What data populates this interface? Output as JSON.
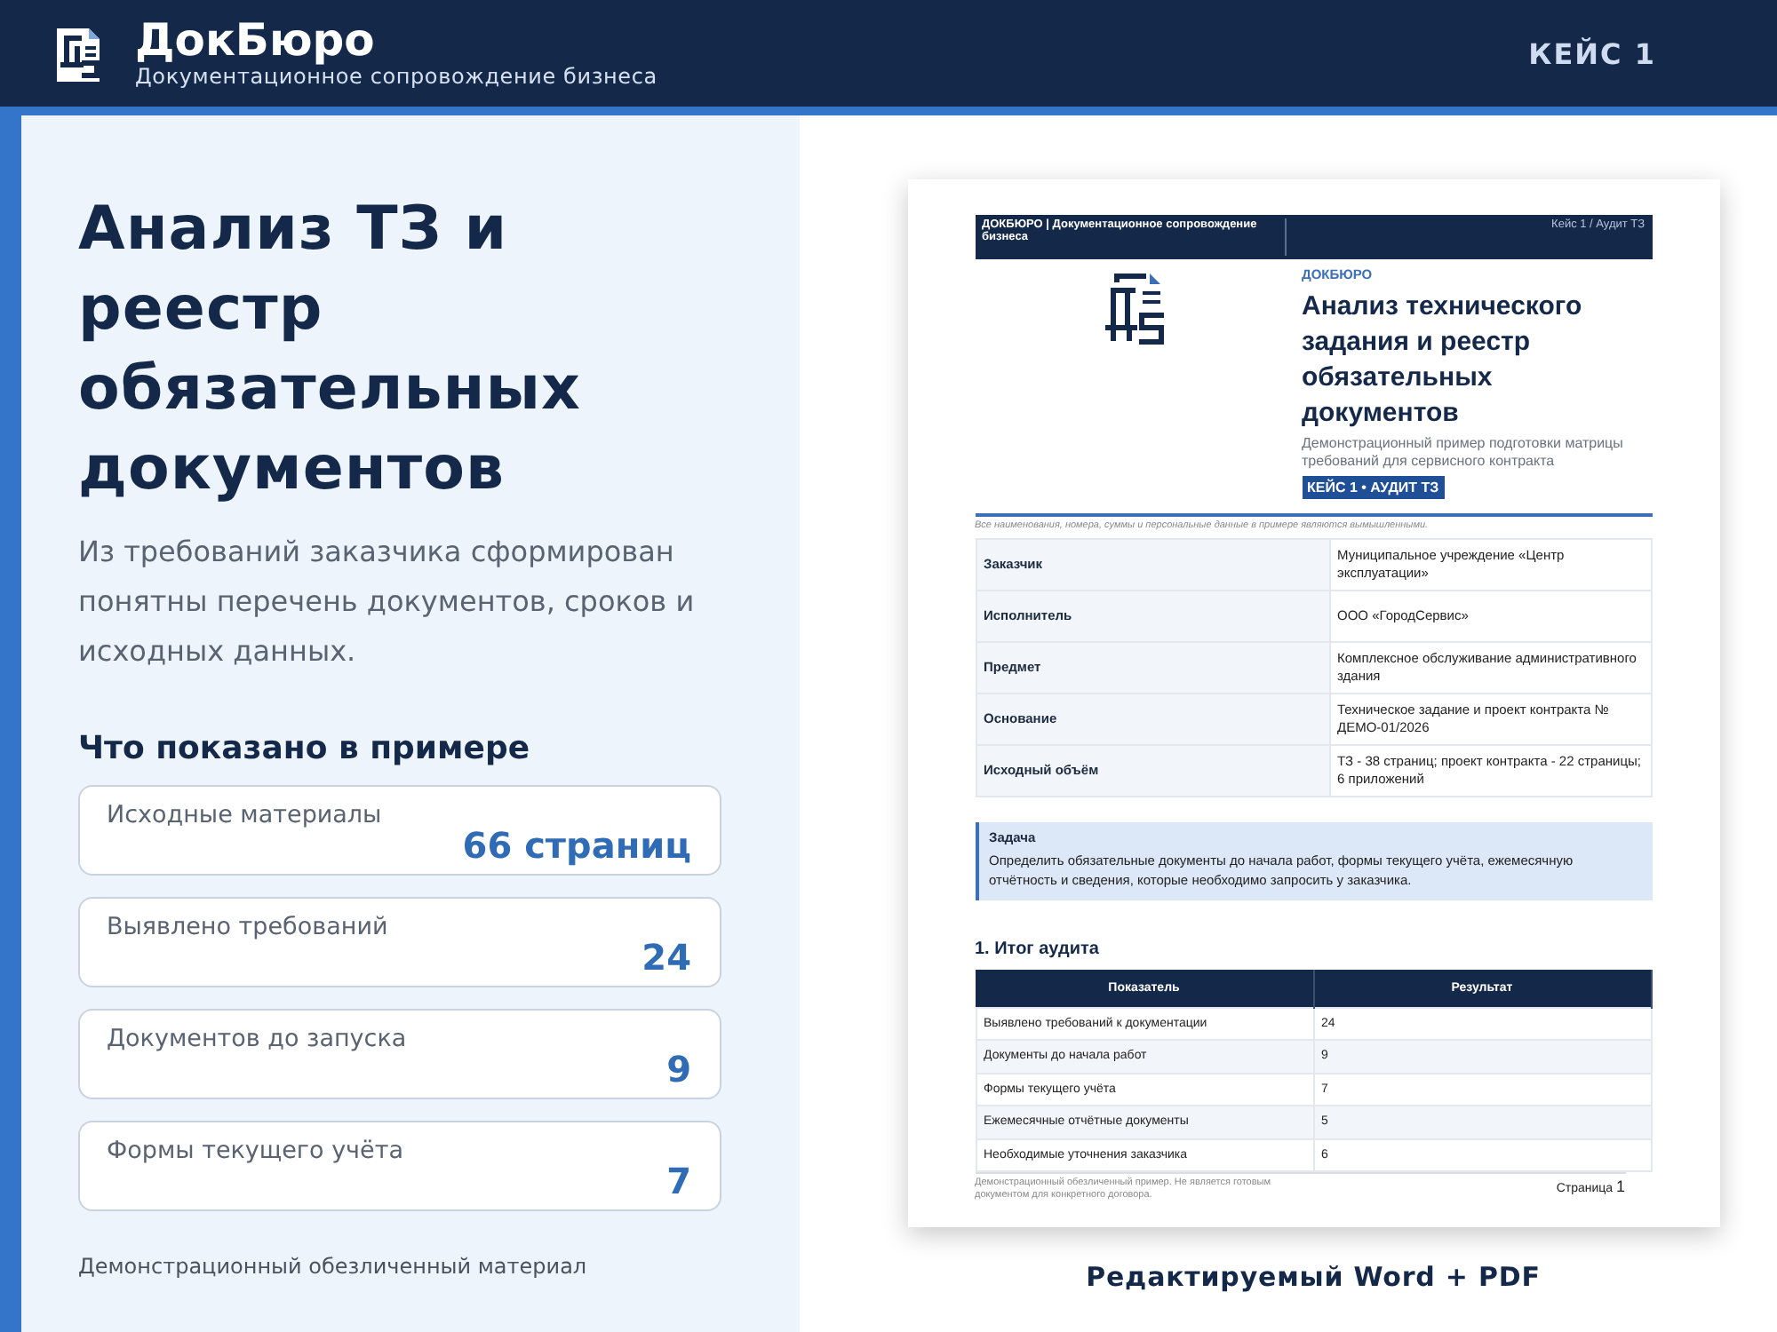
{
  "header": {
    "brand": "ДокБюро",
    "tagline": "Документационное сопровождение бизнеса",
    "case_label": "КЕЙС 1"
  },
  "intro": {
    "title": "Анализ ТЗ и реестр обязательных документов",
    "lead": "Из требований заказчика сформирован понятны перечень документов, сроков и исходных данных.",
    "stats_heading": "Что показано в примере",
    "stats": [
      {
        "label": "Исходные материалы",
        "value": "66 страниц"
      },
      {
        "label": "Выявлено требований",
        "value": "24"
      },
      {
        "label": "Документов до запуска",
        "value": "9"
      },
      {
        "label": "Формы текущего учёта",
        "value": "7"
      }
    ],
    "note": "Демонстрационный обезличенный материал"
  },
  "document": {
    "header_left": "ДОКБЮРО | Документационное сопровождение бизнеса",
    "header_right": "Кейс 1 / Аудит ТЗ",
    "kicker": "ДОКБЮРО",
    "title": "Анализ технического задания и реестр обязательных документов",
    "subtitle": "Демонстрационный пример подготовки матрицы требований для сервисного контракта",
    "tag": "КЕЙС 1 • АУДИТ ТЗ",
    "disclaimer": "Все наименования, номера, суммы и персональные данные в примере являются вымышленными.",
    "info": [
      {
        "label": "Заказчик",
        "value": "Муниципальное учреждение «Центр эксплуатации»"
      },
      {
        "label": "Исполнитель",
        "value": "ООО «ГородСервис»"
      },
      {
        "label": "Предмет",
        "value": "Комплексное обслуживание административного здания"
      },
      {
        "label": "Основание",
        "value": "Техническое задание и проект контракта № ДЕМО-01/2026"
      },
      {
        "label": "Исходный объём",
        "value": "ТЗ - 38 страниц; проект контракта - 22 страницы; 6 приложений"
      }
    ],
    "task": {
      "title": "Задача",
      "text": "Определить обязательные документы до начала работ, формы текущего учёта, ежемесячную отчётность и сведения, которые необходимо запросить у заказчика."
    },
    "section": "1. Итог аудита",
    "columns": [
      "Показатель",
      "Результат"
    ],
    "rows": [
      [
        "Выявлено требований к документации",
        "24"
      ],
      [
        "Документы до начала работ",
        "9"
      ],
      [
        "Формы текущего учёта",
        "7"
      ],
      [
        "Ежемесячные отчётные документы",
        "5"
      ],
      [
        "Необходимые уточнения заказчика",
        "6"
      ]
    ],
    "footer_note": "Демонстрационный обезличенный пример. Не является готовым документом для конкретного договора.",
    "page_label": "Страница",
    "page_number": "1"
  },
  "caption": "Редактируемый Word + PDF"
}
